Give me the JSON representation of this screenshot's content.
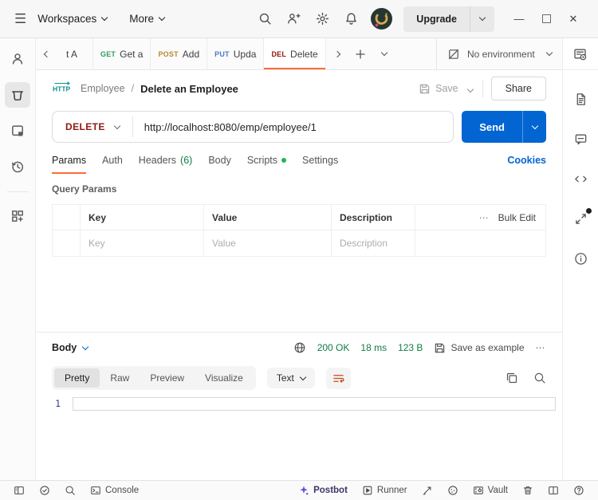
{
  "titlebar": {
    "workspaces": "Workspaces",
    "more": "More",
    "upgrade": "Upgrade"
  },
  "icons": {
    "hamburger": "☰",
    "minimize": "—",
    "close": "✕",
    "ellipsis": "⋯"
  },
  "tabbar": {
    "tabs": [
      {
        "method": "",
        "label": "t A"
      },
      {
        "method": "GET",
        "label": "Get a"
      },
      {
        "method": "POST",
        "label": "Add"
      },
      {
        "method": "PUT",
        "label": "Upda"
      },
      {
        "method": "DEL",
        "label": "Delete"
      }
    ],
    "environment": "No environment"
  },
  "request_header": {
    "protocol_badge": "HTTP",
    "collection": "Employee",
    "separator": "/",
    "name": "Delete an Employee",
    "save_label": "Save",
    "share_label": "Share"
  },
  "url_bar": {
    "method": "DELETE",
    "url": "http://localhost:8080/emp/employee/1",
    "send_label": "Send"
  },
  "request_tabs": {
    "params": "Params",
    "auth": "Auth",
    "headers": "Headers",
    "headers_count": "(6)",
    "body": "Body",
    "scripts": "Scripts",
    "settings": "Settings",
    "cookies": "Cookies"
  },
  "query_params": {
    "section_title": "Query Params",
    "columns": {
      "key": "Key",
      "value": "Value",
      "description": "Description"
    },
    "bulk_edit": "Bulk Edit",
    "placeholders": {
      "key": "Key",
      "value": "Value",
      "description": "Description"
    }
  },
  "response": {
    "body_label": "Body",
    "status": "200 OK",
    "time": "18 ms",
    "size": "123 B",
    "save_as_example": "Save as example",
    "views": {
      "pretty": "Pretty",
      "raw": "Raw",
      "preview": "Preview",
      "visualize": "Visualize"
    },
    "format": "Text",
    "line_number": "1"
  },
  "statusbar": {
    "console": "Console",
    "postbot": "Postbot",
    "runner": "Runner",
    "vault": "Vault"
  },
  "colors": {
    "accent_orange": "#FF6C37",
    "send_blue": "#0265D2",
    "link_blue": "#0265D2",
    "method_get": "#2E9E5F",
    "method_post": "#B98A2D",
    "method_put": "#4E7AC0",
    "method_delete": "#8E1A10",
    "success_green": "#0F7D44",
    "postbot_purple": "#6E4BD4",
    "http_badge_teal": "#0E8F8F"
  }
}
